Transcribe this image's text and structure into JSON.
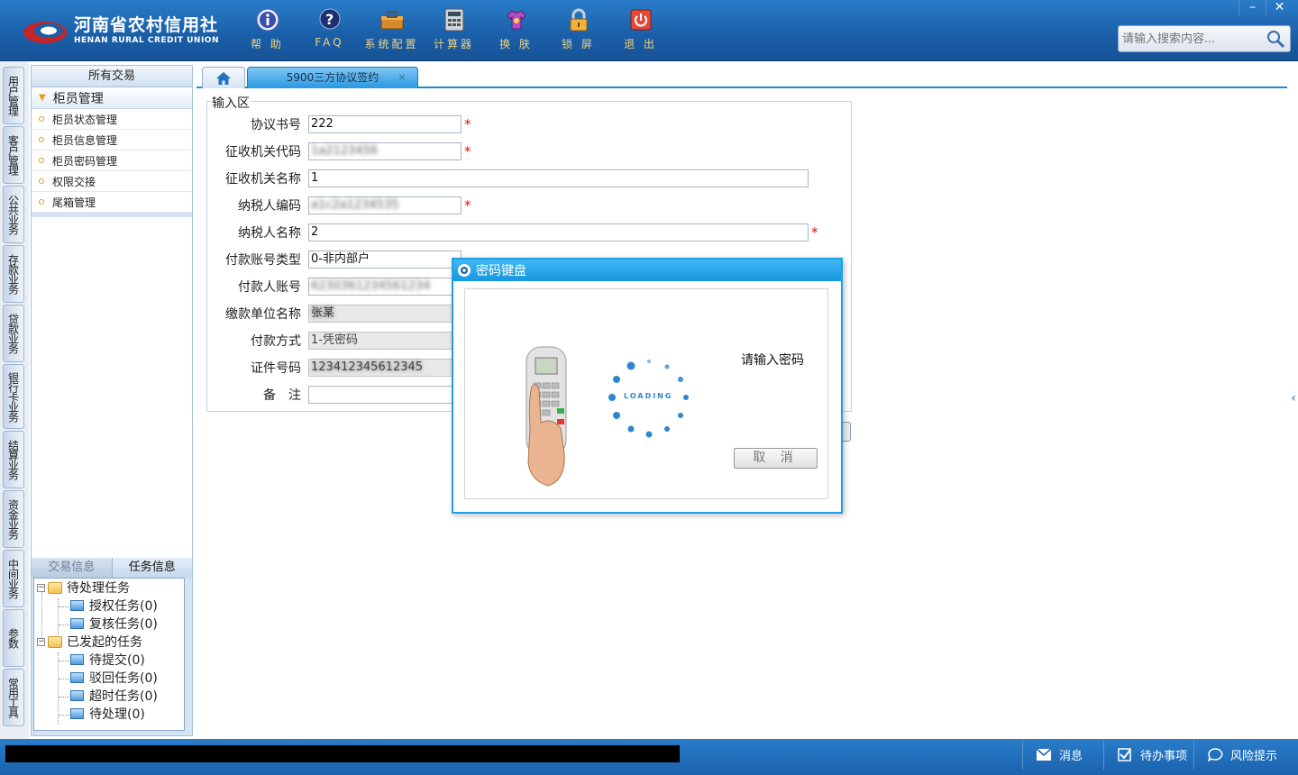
{
  "header": {
    "logo_cn": "河南省农村信用社",
    "logo_en": "HENAN RURAL CREDIT UNION",
    "toolbar": [
      {
        "label": "帮 助",
        "icon": "info-icon"
      },
      {
        "label": "FAQ",
        "icon": "question-icon"
      },
      {
        "label": "系统配置",
        "icon": "toolbox-icon"
      },
      {
        "label": "计算器",
        "icon": "calculator-icon"
      },
      {
        "label": "换 肤",
        "icon": "shirt-icon"
      },
      {
        "label": "锁 屏",
        "icon": "lock-icon"
      },
      {
        "label": "退 出",
        "icon": "power-icon"
      }
    ],
    "window": {
      "minimize": "–",
      "close": "✕"
    },
    "search_placeholder": "请输入搜索内容..."
  },
  "vnav": [
    "用户管理",
    "客户管理",
    "公共业务",
    "存款业务",
    "贷款业务",
    "银行卡业务",
    "结算业务",
    "资金业务",
    "中间业务",
    "参数",
    "常用工具"
  ],
  "left_panel": {
    "title": "所有交易",
    "group": "柜员管理",
    "items": [
      "柜员状态管理",
      "柜员信息管理",
      "柜员密码管理",
      "权限交接",
      "尾箱管理"
    ],
    "task_tabs": [
      "交易信息",
      "任务信息"
    ],
    "tree": {
      "pending": "待处理任务",
      "auth": "授权任务(0)",
      "review": "复核任务(0)",
      "initiated": "已发起的任务",
      "to_submit": "待提交(0)",
      "rejected": "驳回任务(0)",
      "timeout": "超时任务(0)",
      "to_process": "待处理(0)"
    }
  },
  "main": {
    "tab_title": "5900三方协议签约",
    "tab_close": "×",
    "legend": "输入区",
    "fields": {
      "agreement_no": {
        "label": "协议书号",
        "value": "222"
      },
      "org_code": {
        "label": "征收机关代码",
        "value": "1a2123456"
      },
      "org_name": {
        "label": "征收机关名称",
        "value": "1"
      },
      "taxpayer_code": {
        "label": "纳税人编码",
        "value": "a1c2a1234535"
      },
      "taxpayer_name": {
        "label": "纳税人名称",
        "value": "2"
      },
      "account_type": {
        "label": "付款账号类型",
        "value": "0-非内部户"
      },
      "payer_account": {
        "label": "付款人账号",
        "value": "6230361234561234"
      },
      "unit_name": {
        "label": "缴款单位名称",
        "value": "张某"
      },
      "pay_method": {
        "label": "付款方式",
        "value": "1-凭密码"
      },
      "id_no": {
        "label": "证件号码",
        "value": "123412345612345"
      },
      "remark": {
        "label": "备　注",
        "value": ""
      }
    }
  },
  "modal": {
    "title": "密码键盘",
    "loading": "LOADING",
    "message": "请输入密码",
    "cancel": "取 消"
  },
  "statusbar": {
    "messages": "消息",
    "todo": "待办事项",
    "risk": "风险提示"
  },
  "colors": {
    "header_blue": "#1a5ea8",
    "accent_blue": "#1da0e6",
    "required_red": "#d11111",
    "toolbar_label": "#f1d27a"
  }
}
